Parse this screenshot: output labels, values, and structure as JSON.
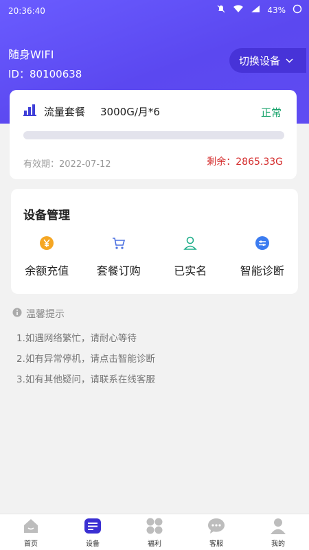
{
  "status_bar": {
    "time": "20:36:40",
    "battery": "43%"
  },
  "device": {
    "name": "随身WIFI",
    "id": "ID：80100638",
    "switch_label": "切换设备"
  },
  "plan": {
    "title": "流量套餐",
    "value": "3000G/月*6",
    "status": "正常",
    "status_color": "#18a36b",
    "expire": "有效期：2022-07-12",
    "remaining": "剩余：2865.33G",
    "remaining_color": "#d42b2b"
  },
  "management": {
    "title": "设备管理",
    "items": [
      {
        "label": "余额充值",
        "icon": "yen-coin-icon"
      },
      {
        "label": "套餐订购",
        "icon": "cart-icon"
      },
      {
        "label": "已实名",
        "icon": "user-verified-icon"
      },
      {
        "label": "智能诊断",
        "icon": "diagnosis-icon"
      }
    ]
  },
  "tips": {
    "title": "温馨提示",
    "items": [
      "1.如遇网络繁忙，请耐心等待",
      "2.如有异常停机，请点击智能诊断",
      "3.如有其他疑问，请联系在线客服"
    ]
  },
  "tabbar": {
    "items": [
      {
        "label": "首页",
        "icon": "home-icon"
      },
      {
        "label": "设备",
        "icon": "device-icon",
        "active": true
      },
      {
        "label": "福利",
        "icon": "grid-icon"
      },
      {
        "label": "客服",
        "icon": "chat-icon"
      },
      {
        "label": "我的",
        "icon": "profile-icon"
      }
    ]
  },
  "colors": {
    "header": "#5b48f0",
    "accent": "#4733d8"
  }
}
